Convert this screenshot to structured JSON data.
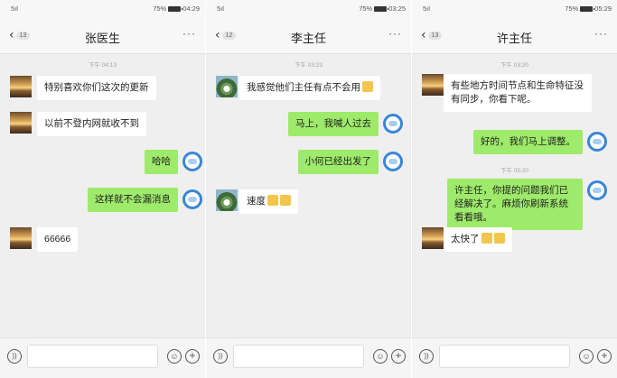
{
  "colors": {
    "outgoing_bubble": "#9eea6a",
    "incoming_bubble": "#ffffff",
    "chat_bg": "#efefef",
    "avatar_ring": "#3a86d6"
  },
  "icons": {
    "back": "chevron-left-icon",
    "more": "more-icon",
    "voice": "voice-icon",
    "emoji": "emoji-icon",
    "plus": "plus-icon"
  },
  "chats": [
    {
      "status": {
        "signal": "5ıl",
        "battery_pct": "75%",
        "time": "04:29"
      },
      "back_count": "13",
      "title": "张医生",
      "more": "···",
      "timestamp": "下午 04:13",
      "messages": [
        {
          "side": "in",
          "text": "特别喜欢你们这次的更新"
        },
        {
          "side": "in",
          "text": "以前不登内网就收不到"
        },
        {
          "side": "out",
          "text": "哈哈"
        },
        {
          "side": "out",
          "text": "这样就不会漏消息"
        },
        {
          "side": "in",
          "text": "66666"
        }
      ]
    },
    {
      "status": {
        "signal": "5ıl",
        "battery_pct": "75%",
        "time": "03:25"
      },
      "back_count": "12",
      "title": "李主任",
      "more": "···",
      "timestamp": "下午 03:23",
      "messages": [
        {
          "side": "in",
          "text": "我感觉他们主任有点不会用"
        },
        {
          "side": "out",
          "text": "马上，我喊人过去"
        },
        {
          "side": "out",
          "text": "小何已经出发了"
        },
        {
          "side": "in",
          "text": "速度"
        }
      ]
    },
    {
      "status": {
        "signal": "5ıl",
        "battery_pct": "75%",
        "time": "05:29"
      },
      "back_count": "13",
      "title": "许主任",
      "more": "···",
      "timestamp": "下午 03:20",
      "timestamp2": "下午 05:20",
      "messages": [
        {
          "side": "in",
          "text": "有些地方时间节点和生命特征没有同步，你看下呢。"
        },
        {
          "side": "out",
          "text": "好的，我们马上调整。"
        },
        {
          "side": "out",
          "text": "许主任，你提的问题我们已经解决了。麻烦你刷新系统看看哦。"
        },
        {
          "side": "in",
          "text": "太快了"
        }
      ]
    }
  ]
}
